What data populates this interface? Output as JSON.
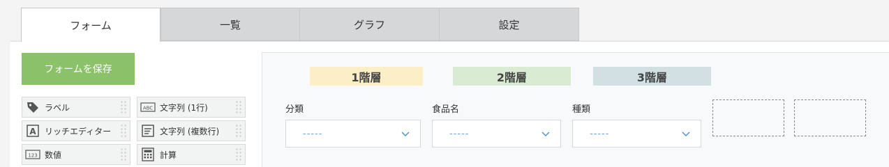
{
  "tabs": [
    {
      "label": "フォーム",
      "active": true
    },
    {
      "label": "一覧",
      "active": false
    },
    {
      "label": "グラフ",
      "active": false
    },
    {
      "label": "設定",
      "active": false
    }
  ],
  "save_button": {
    "label": "フォームを保存",
    "color": "#8bc169"
  },
  "palette": [
    {
      "label": "ラベル",
      "icon": "tag-icon"
    },
    {
      "label": "文字列 (1行)",
      "icon": "abc-text-icon"
    },
    {
      "label": "リッチエディター",
      "icon": "rich-editor-icon"
    },
    {
      "label": "文字列 (複数行)",
      "icon": "multiline-text-icon"
    },
    {
      "label": "数値",
      "icon": "number-icon"
    },
    {
      "label": "計算",
      "icon": "calculator-icon"
    }
  ],
  "levels": [
    {
      "label": "1階層",
      "color": "#fcefc6"
    },
    {
      "label": "2階層",
      "color": "#d9ebd3"
    },
    {
      "label": "3階層",
      "color": "#d0e0e3"
    }
  ],
  "fields": [
    {
      "label": "分類",
      "value": "-----"
    },
    {
      "label": "食品名",
      "value": "-----"
    },
    {
      "label": "種類",
      "value": "-----"
    }
  ]
}
